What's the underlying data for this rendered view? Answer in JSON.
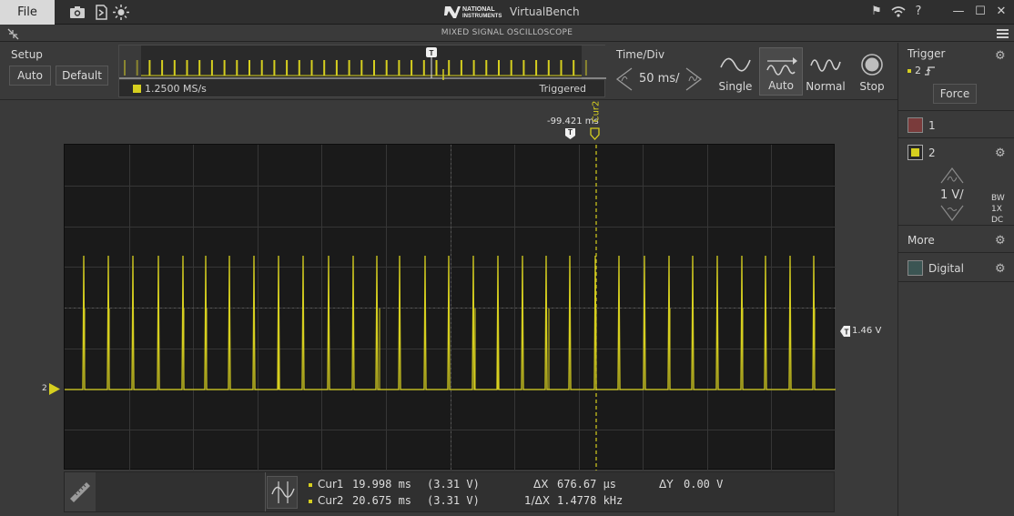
{
  "titlebar": {
    "file_label": "File",
    "brand_line1": "NATIONAL",
    "brand_line2": "INSTRUMENTS",
    "app_title": "VirtualBench"
  },
  "instrument_title": "MIXED SIGNAL OSCILLOSCOPE",
  "setup": {
    "label": "Setup",
    "auto_label": "Auto",
    "default_label": "Default"
  },
  "overview": {
    "sample_rate": "1.2500 MS/s",
    "trigger_status": "Triggered",
    "trigger_marker": "T"
  },
  "timebase": {
    "label": "Time/Div",
    "value": "50 ms/"
  },
  "acquisition_modes": [
    {
      "label": "Single"
    },
    {
      "label": "Auto"
    },
    {
      "label": "Normal"
    },
    {
      "label": "Stop"
    }
  ],
  "trigger_panel": {
    "title": "Trigger",
    "source": "2",
    "force_label": "Force"
  },
  "channels": [
    {
      "number": "1",
      "color": "#7a3b3b"
    },
    {
      "number": "2",
      "color": "#d6cf1f",
      "scale": "1 V/",
      "bw": "BW",
      "probe": "1X",
      "coupling": "DC"
    }
  ],
  "more_label": "More",
  "digital_label": "Digital",
  "waveform": {
    "color": "#d6cf1f",
    "trigger_time_label": "-99.421 ms",
    "cursor_label": "Cur2",
    "trigger_level_label": "1.46 V",
    "channel_marker": "2"
  },
  "cursors": {
    "cur1_label": "Cur1",
    "cur1_time": "19.998 ms",
    "cur1_volt": "(3.31 V)",
    "cur2_label": "Cur2",
    "cur2_time": "20.675 ms",
    "cur2_volt": "(3.31 V)",
    "dx_label": "ΔX",
    "dx_value": "676.67 μs",
    "inv_dx_label": "1/ΔX",
    "inv_dx_value": "1.4778 kHz",
    "dy_label": "ΔY",
    "dy_value": "0.00 V"
  }
}
